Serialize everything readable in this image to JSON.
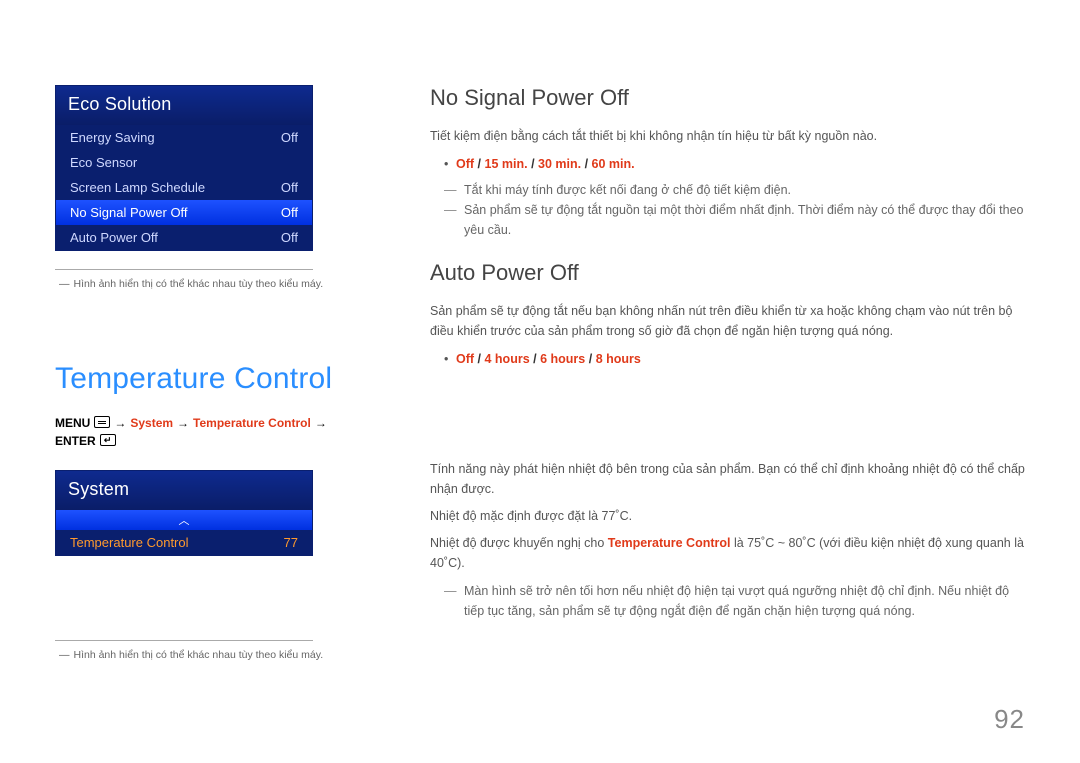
{
  "page_number": "92",
  "osd_eco": {
    "title": "Eco Solution",
    "rows": [
      {
        "label": "Energy Saving",
        "value": "Off"
      },
      {
        "label": "Eco Sensor",
        "value": ""
      },
      {
        "label": "Screen Lamp Schedule",
        "value": "Off"
      },
      {
        "label": "No Signal Power Off",
        "value": "Off"
      },
      {
        "label": "Auto Power Off",
        "value": "Off"
      }
    ],
    "caption": "Hình ảnh hiển thị có thể khác nhau tùy theo kiểu máy."
  },
  "section2": {
    "heading": "Temperature Control",
    "breadcrumb": {
      "prefix": "MENU",
      "arrow": "→",
      "part1": "System",
      "part2": "Temperature Control",
      "suffix": "ENTER"
    }
  },
  "osd_system": {
    "title": "System",
    "row": {
      "label": "Temperature Control",
      "value": "77"
    },
    "caption": "Hình ảnh hiển thị có thể khác nhau tùy theo kiểu máy."
  },
  "right": {
    "h1": "No Signal Power Off",
    "p1": "Tiết kiệm điện bằng cách tắt thiết bị khi không nhận tín hiệu từ bất kỳ nguồn nào.",
    "options1": [
      "Off",
      "15 min.",
      "30 min.",
      "60 min."
    ],
    "notes1": [
      "Tắt khi máy tính được kết nối đang ở chế độ tiết kiệm điện.",
      "Sản phẩm sẽ tự động tắt nguồn tại một thời điểm nhất định. Thời điểm này có thể được thay đổi theo yêu cầu."
    ],
    "h2": "Auto Power Off",
    "p2": "Sản phẩm sẽ tự động tắt nếu bạn không nhấn nút trên điều khiển từ xa hoặc không chạm vào nút trên bộ điều khiển trước của sản phẩm trong số giờ đã chọn để ngăn hiện tượng quá nóng.",
    "options2": [
      "Off",
      "4 hours",
      "6 hours",
      "8 hours"
    ],
    "temp_p1": "Tính năng này phát hiện nhiệt độ bên trong của sản phẩm. Bạn có thể chỉ định khoảng nhiệt độ có thể chấp nhận được.",
    "temp_p2": "Nhiệt độ mặc định được đặt là 77˚C.",
    "temp_p3_a": "Nhiệt độ được khuyến nghị cho ",
    "temp_p3_b": "Temperature Control",
    "temp_p3_c": " là 75˚C ~ 80˚C (với điều kiện nhiệt độ xung quanh là 40˚C).",
    "temp_note": "Màn hình sẽ trở nên tối hơn nếu nhiệt độ hiện tại vượt quá ngưỡng nhiệt độ chỉ định. Nếu nhiệt độ tiếp tục tăng, sản phẩm sẽ tự động ngắt điện để ngăn chặn hiện tượng quá nóng."
  }
}
